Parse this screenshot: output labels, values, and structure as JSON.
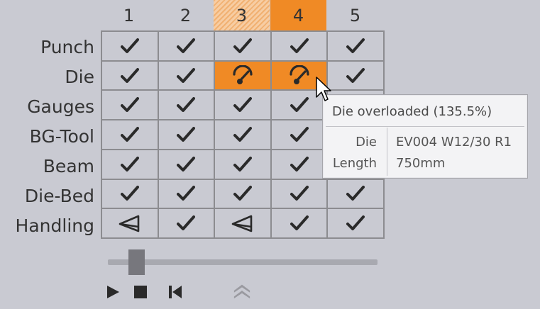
{
  "columns": [
    {
      "label": "1",
      "state": "ok"
    },
    {
      "label": "2",
      "state": "ok"
    },
    {
      "label": "3",
      "state": "warning"
    },
    {
      "label": "4",
      "state": "error"
    },
    {
      "label": "5",
      "state": "ok"
    }
  ],
  "rows": [
    {
      "label": "Punch",
      "cells": [
        "check",
        "check",
        "check",
        "check",
        "check"
      ]
    },
    {
      "label": "Die",
      "cells": [
        "check",
        "check",
        "gauge-error",
        "gauge-error",
        "check"
      ]
    },
    {
      "label": "Gauges",
      "cells": [
        "check",
        "check",
        "check",
        "check",
        "check"
      ]
    },
    {
      "label": "BG-Tool",
      "cells": [
        "check",
        "check",
        "check",
        "check",
        "check"
      ]
    },
    {
      "label": "Beam",
      "cells": [
        "check",
        "check",
        "check",
        "check",
        "check"
      ]
    },
    {
      "label": "Die-Bed",
      "cells": [
        "check",
        "check",
        "check",
        "check",
        "check"
      ]
    },
    {
      "label": "Handling",
      "cells": [
        "gripper",
        "check",
        "gripper",
        "check",
        "check"
      ]
    }
  ],
  "tooltip": {
    "title": "Die overloaded (135.5%)",
    "rows": [
      {
        "key": "Die",
        "value": "EV004 W12/30 R1"
      },
      {
        "key": "Length",
        "value": "750mm"
      }
    ]
  },
  "slider": {
    "position": 0.08
  },
  "controls": [
    "play-icon",
    "stop-icon",
    "skip-back-icon",
    "collapse-up-icon"
  ],
  "colors": {
    "background": "#c9cad2",
    "error": "#f08a25",
    "warning_stripe": "#f1b172",
    "grid": "#8c8c90",
    "icon": "#2a2a2a"
  }
}
